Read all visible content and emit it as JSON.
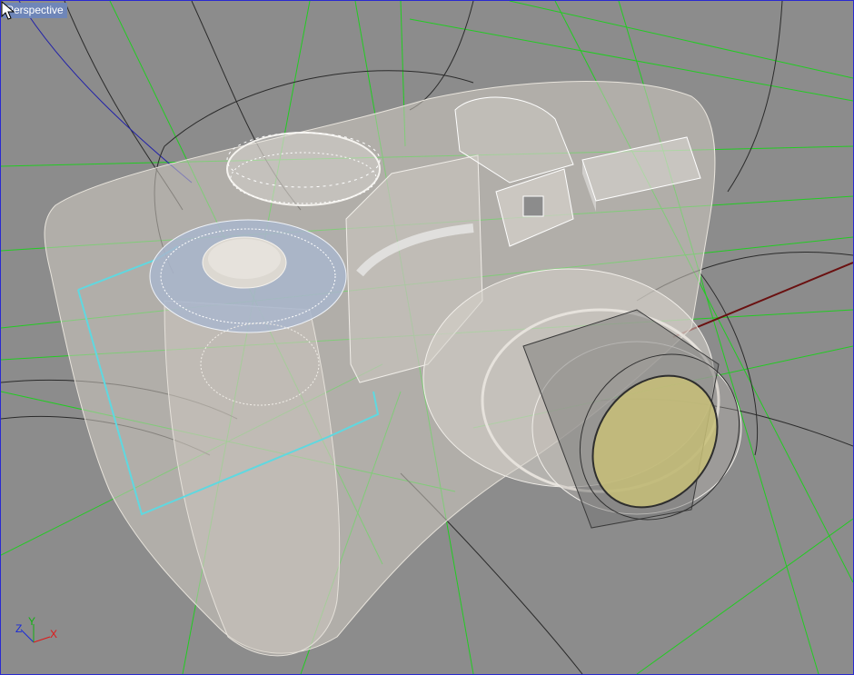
{
  "viewport": {
    "label": "Perspective",
    "colors": {
      "background": "#8c8c8c",
      "border": "#2a2ad0",
      "grid_green": "#22cc22",
      "body_shell": "#cfcac1",
      "selected_dial": "#a9b6cc",
      "lens_glass": "#c8bf78",
      "axis_x_line": "#6a1010"
    }
  },
  "axis_tripod": {
    "z": "Z",
    "y": "Y",
    "x": "X"
  },
  "icons": {
    "cursor": "arrow-cursor-icon"
  }
}
